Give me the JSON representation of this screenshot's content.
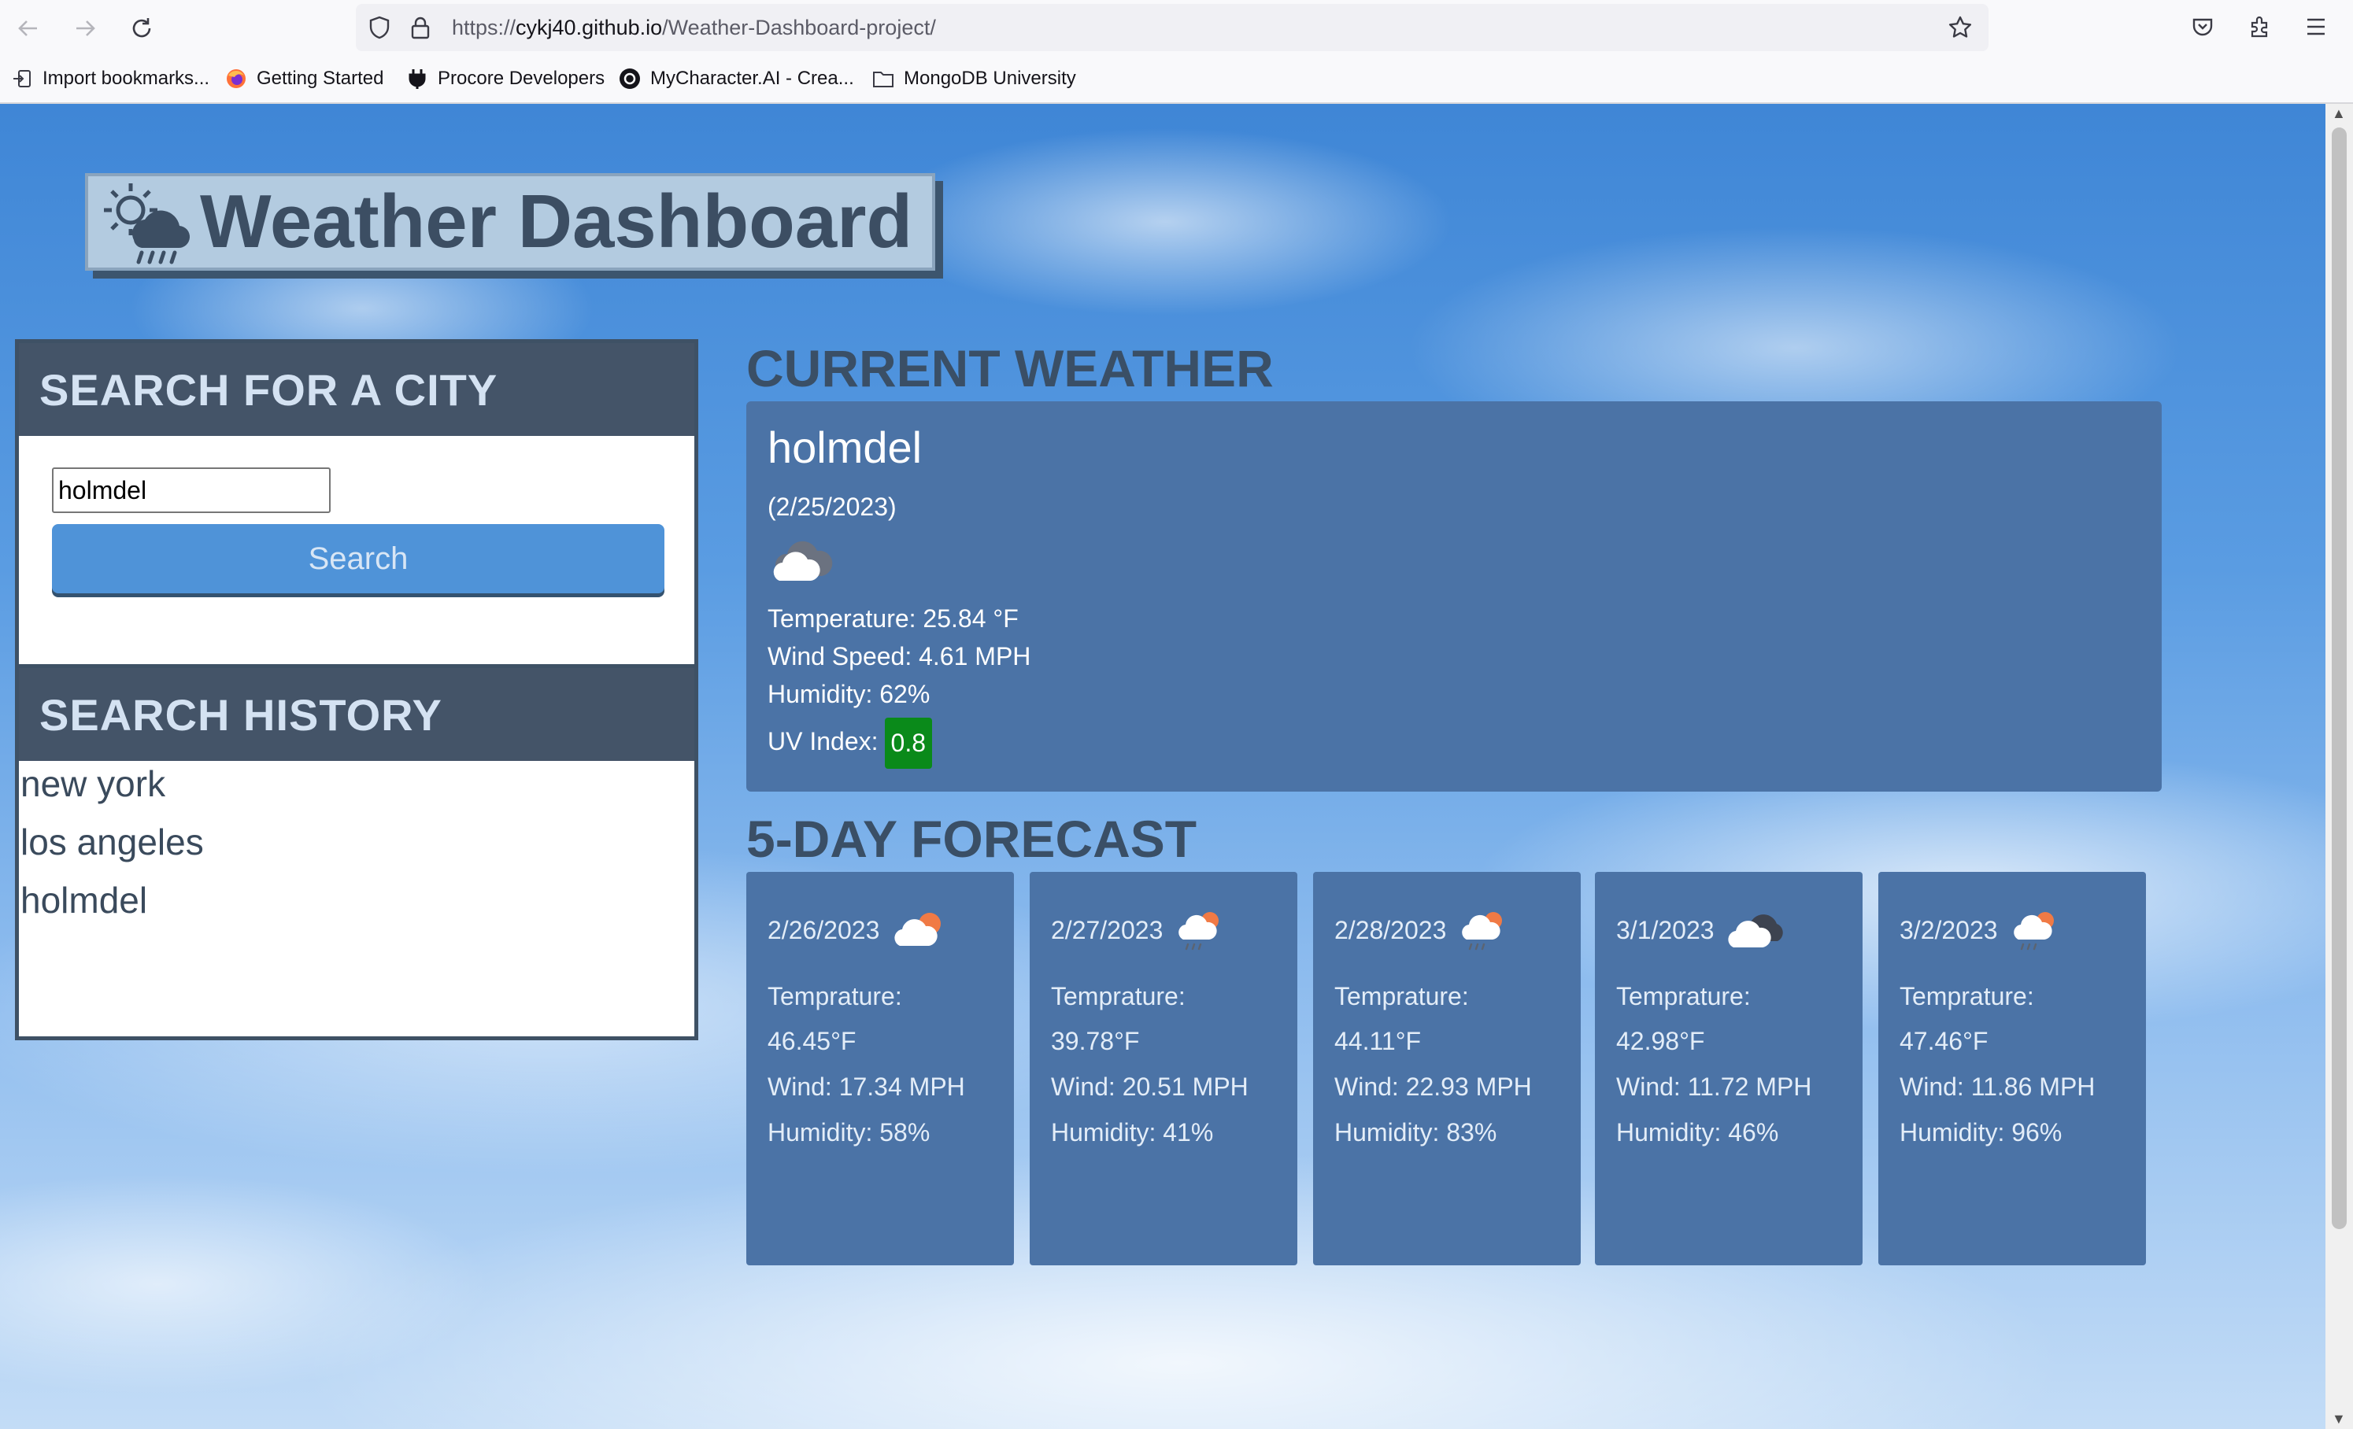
{
  "browser": {
    "url_prefix": "https://",
    "url_host": "cykj40.github.io",
    "url_path": "/Weather-Dashboard-project/",
    "bookmarks": [
      {
        "label": "Import bookmarks...",
        "icon": "import-icon"
      },
      {
        "label": "Getting Started",
        "icon": "firefox-icon"
      },
      {
        "label": "Procore Developers",
        "icon": "plug-icon"
      },
      {
        "label": "MyCharacter.AI - Crea...",
        "icon": "site-icon"
      },
      {
        "label": "MongoDB University",
        "icon": "folder-icon"
      }
    ]
  },
  "header": {
    "title": "Weather Dashboard",
    "icon": "sun-rain-cloud-icon"
  },
  "search": {
    "heading": "SEARCH FOR A CITY",
    "input_value": "holmdel",
    "button_label": "Search"
  },
  "history": {
    "heading": "SEARCH HISTORY",
    "items": [
      "new york",
      "los angeles",
      "holmdel"
    ]
  },
  "current": {
    "heading": "CURRENT WEATHER",
    "city": "holmdel",
    "date": "(2/25/2023)",
    "icon": "cloud-icon",
    "temperature": "Temperature: 25.84 °F",
    "wind": "Wind Speed: 4.61 MPH",
    "humidity": "Humidity: 62%",
    "uv_label": "UV Index:",
    "uv_value": "0.8",
    "uv_color": "#0a8a1a"
  },
  "forecast": {
    "heading": "5-DAY FORECAST",
    "days": [
      {
        "date": "2/26/2023",
        "icon": "sun-cloud-icon",
        "temp_label": "Temprature:",
        "temp": "46.45°F",
        "wind": "Wind: 17.34 MPH",
        "humidity": "Humidity: 58%"
      },
      {
        "date": "2/27/2023",
        "icon": "sun-cloud-rain-icon",
        "temp_label": "Temprature:",
        "temp": "39.78°F",
        "wind": "Wind: 20.51 MPH",
        "humidity": "Humidity: 41%"
      },
      {
        "date": "2/28/2023",
        "icon": "sun-cloud-rain-icon",
        "temp_label": "Temprature:",
        "temp": "44.11°F",
        "wind": "Wind: 22.93 MPH",
        "humidity": "Humidity: 83%"
      },
      {
        "date": "3/1/2023",
        "icon": "dark-cloud-icon",
        "temp_label": "Temprature:",
        "temp": "42.98°F",
        "wind": "Wind: 11.72 MPH",
        "humidity": "Humidity: 46%"
      },
      {
        "date": "3/2/2023",
        "icon": "sun-cloud-rain-icon",
        "temp_label": "Temprature:",
        "temp": "47.46°F",
        "wind": "Wind: 11.86 MPH",
        "humidity": "Humidity: 96%"
      }
    ]
  },
  "colors": {
    "card": "#4b73a6",
    "panel_header": "#445468",
    "button": "#4f93d8"
  }
}
